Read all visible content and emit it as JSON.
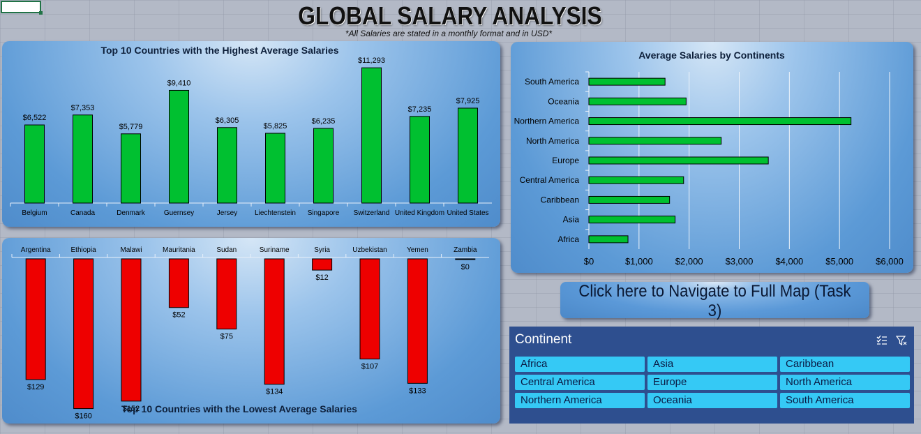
{
  "header": {
    "title": "GLOBAL SALARY ANALYSIS",
    "subtitle": "*All Salaries are stated in a monthly format and in USD*"
  },
  "colors": {
    "highest_bar": "#00c030",
    "lowest_bar": "#ee0000",
    "continent_bar": "#00c030",
    "slicer_bg": "#2e4f8f",
    "slicer_item": "#35c9f5"
  },
  "nav_button": {
    "label": "Click here to Navigate to Full Map (Task 3)"
  },
  "slicer": {
    "title": "Continent",
    "multiselect_icon": "multi-select-icon",
    "clear_filter_icon": "clear-filter-icon",
    "items": [
      "Africa",
      "Asia",
      "Caribbean",
      "Central America",
      "Europe",
      "North America",
      "Northern America",
      "Oceania",
      "South America"
    ]
  },
  "chart_data": [
    {
      "id": "highest",
      "type": "bar",
      "title": "Top 10 Countries with the Highest Average Salaries",
      "categories": [
        "Belgium",
        "Canada",
        "Denmark",
        "Guernsey",
        "Jersey",
        "Liechtenstein",
        "Singapore",
        "Switzerland",
        "United Kingdom",
        "United States"
      ],
      "values": [
        6522,
        7353,
        5779,
        9410,
        6305,
        5825,
        6235,
        11293,
        7235,
        7925
      ],
      "data_labels": [
        "$6,522",
        "$7,353",
        "$5,779",
        "$9,410",
        "$6,305",
        "$5,825",
        "$6,235",
        "$11,293",
        "$7,235",
        "$7,925"
      ],
      "ylim": [
        0,
        12000
      ],
      "grid": false,
      "legend": "none"
    },
    {
      "id": "lowest",
      "type": "bar",
      "title": "Top 10 Countries with the Lowest Average Salaries",
      "categories": [
        "Argentina",
        "Ethiopia",
        "Malawi",
        "Mauritania",
        "Sudan",
        "Suriname",
        "Syria",
        "Uzbekistan",
        "Yemen",
        "Zambia"
      ],
      "values": [
        129,
        160,
        152,
        52,
        75,
        134,
        12,
        107,
        133,
        0
      ],
      "data_labels": [
        "$129",
        "$160",
        "$152",
        "$52",
        "$75",
        "$134",
        "$12",
        "$107",
        "$133",
        "$0"
      ],
      "orientation": "downward",
      "ylim": [
        0,
        170
      ],
      "grid": false,
      "legend": "none"
    },
    {
      "id": "continents",
      "type": "bar",
      "orientation": "horizontal",
      "title": "Average Salaries by Continents",
      "categories": [
        "South America",
        "Oceania",
        "Northern America",
        "North America",
        "Europe",
        "Central America",
        "Caribbean",
        "Asia",
        "Africa"
      ],
      "values": [
        1520,
        1940,
        5230,
        2640,
        3580,
        1890,
        1610,
        1720,
        780
      ],
      "xticks": [
        "$0",
        "$1,000",
        "$2,000",
        "$3,000",
        "$4,000",
        "$5,000",
        "$6,000"
      ],
      "xlim": [
        0,
        6000
      ],
      "grid": true,
      "legend": "none"
    }
  ]
}
